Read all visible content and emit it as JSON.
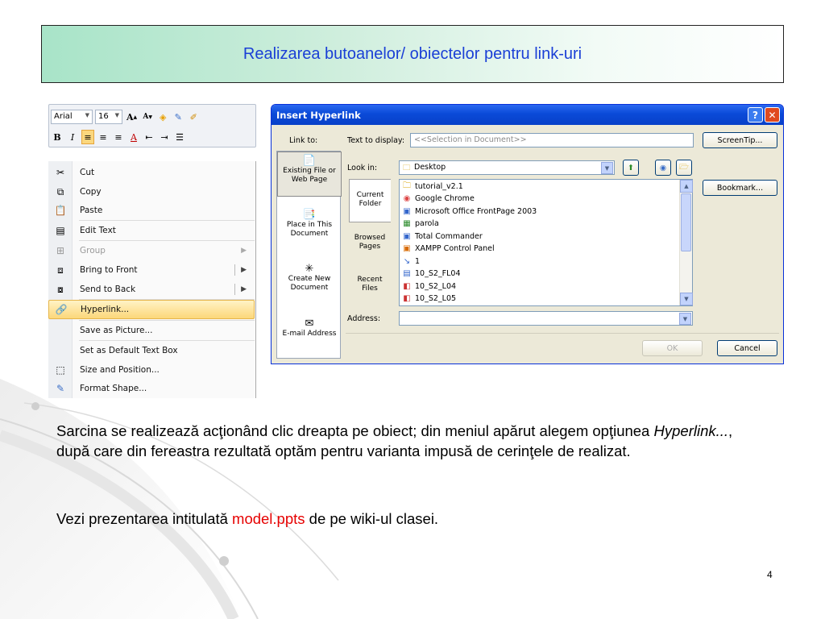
{
  "slide": {
    "title": "Realizarea butoanelor/ obiectelor pentru link-uri",
    "body_part1": "Sarcina se realizează acţionând clic dreapta pe obiect; din meniul apărut alegem opţiunea ",
    "body_italic": "Hyperlink...",
    "body_part2": ", după care din fereastra rezultată optăm pentru varianta impusă de cerinţele de realizat.",
    "line2_prefix": "Vezi prezentarea intitulată ",
    "line2_link": "model.ppts",
    "line2_suffix": " de pe wiki-ul clasei.",
    "page_number": "4",
    "accent_color": "#1a3fd6",
    "link_color": "#e60000"
  },
  "toolbar": {
    "font": "Arial",
    "size": "16",
    "grow": "A",
    "shrink": "A",
    "bold": "B",
    "italic": "I"
  },
  "context_menu": {
    "items": [
      {
        "label": "Cut",
        "icon": "scissors-icon"
      },
      {
        "label": "Copy",
        "icon": "copy-icon"
      },
      {
        "label": "Paste",
        "icon": "paste-icon"
      },
      {
        "label": "Edit Text",
        "icon": "edit-text-icon"
      },
      {
        "label": "Group",
        "icon": "group-icon",
        "disabled": true
      },
      {
        "label": "Bring to Front",
        "icon": "bring-front-icon"
      },
      {
        "label": "Send to Back",
        "icon": "send-back-icon"
      },
      {
        "label": "Hyperlink...",
        "icon": "hyperlink-icon",
        "highlighted": true
      },
      {
        "label": "Save as Picture...",
        "icon": ""
      },
      {
        "label": "Set as Default Text Box",
        "icon": ""
      },
      {
        "label": "Size and Position...",
        "icon": "size-position-icon"
      },
      {
        "label": "Format Shape...",
        "icon": "format-shape-icon"
      }
    ]
  },
  "dialog": {
    "title": "Insert Hyperlink",
    "help": "?",
    "close": "✕",
    "link_to": "Link to:",
    "text_to_display_label": "Text to display:",
    "text_to_display_value": "<<Selection in Document>>",
    "screentip": "ScreenTip...",
    "look_in_label": "Look in:",
    "look_in_value": "Desktop",
    "bookmark": "Bookmark...",
    "address_label": "Address:",
    "ok": "OK",
    "cancel": "Cancel",
    "link_types": [
      "Existing File or Web Page",
      "Place in This Document",
      "Create New Document",
      "E-mail Address"
    ],
    "side_tabs": [
      "Current Folder",
      "Browsed Pages",
      "Recent Files"
    ],
    "files": [
      "tutorial_v2.1",
      "Google Chrome",
      "Microsoft Office FrontPage 2003",
      "parola",
      "Total Commander",
      "XAMPP Control Panel",
      "1",
      "10_S2_FL04",
      "10_S2_L04",
      "10_S2_L05"
    ]
  }
}
